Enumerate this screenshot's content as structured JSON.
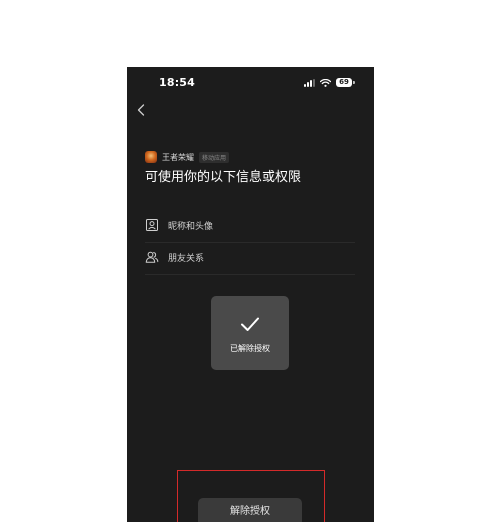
{
  "status_bar": {
    "time": "18:54",
    "battery": "69",
    "icons": [
      "signal-icon",
      "wifi-icon",
      "battery-icon"
    ]
  },
  "header": {
    "back_icon": "chevron-left-icon"
  },
  "app": {
    "name": "王者荣耀",
    "tag": "移动应用",
    "logo": "app-logo"
  },
  "headline": "可使用你的以下信息或权限",
  "permissions": [
    {
      "label": "昵称和头像",
      "icon": "profile-card-icon"
    },
    {
      "label": "朋友关系",
      "icon": "friends-icon"
    }
  ],
  "toast": {
    "text": "已解除授权",
    "icon": "checkmark-icon"
  },
  "actions": {
    "revoke_label": "解除授权"
  },
  "colors": {
    "screen_bg": "#1c1c1c",
    "toast_bg": "#4a4a4a",
    "button_bg": "#3a3a3a",
    "highlight": "#d42a2a"
  }
}
